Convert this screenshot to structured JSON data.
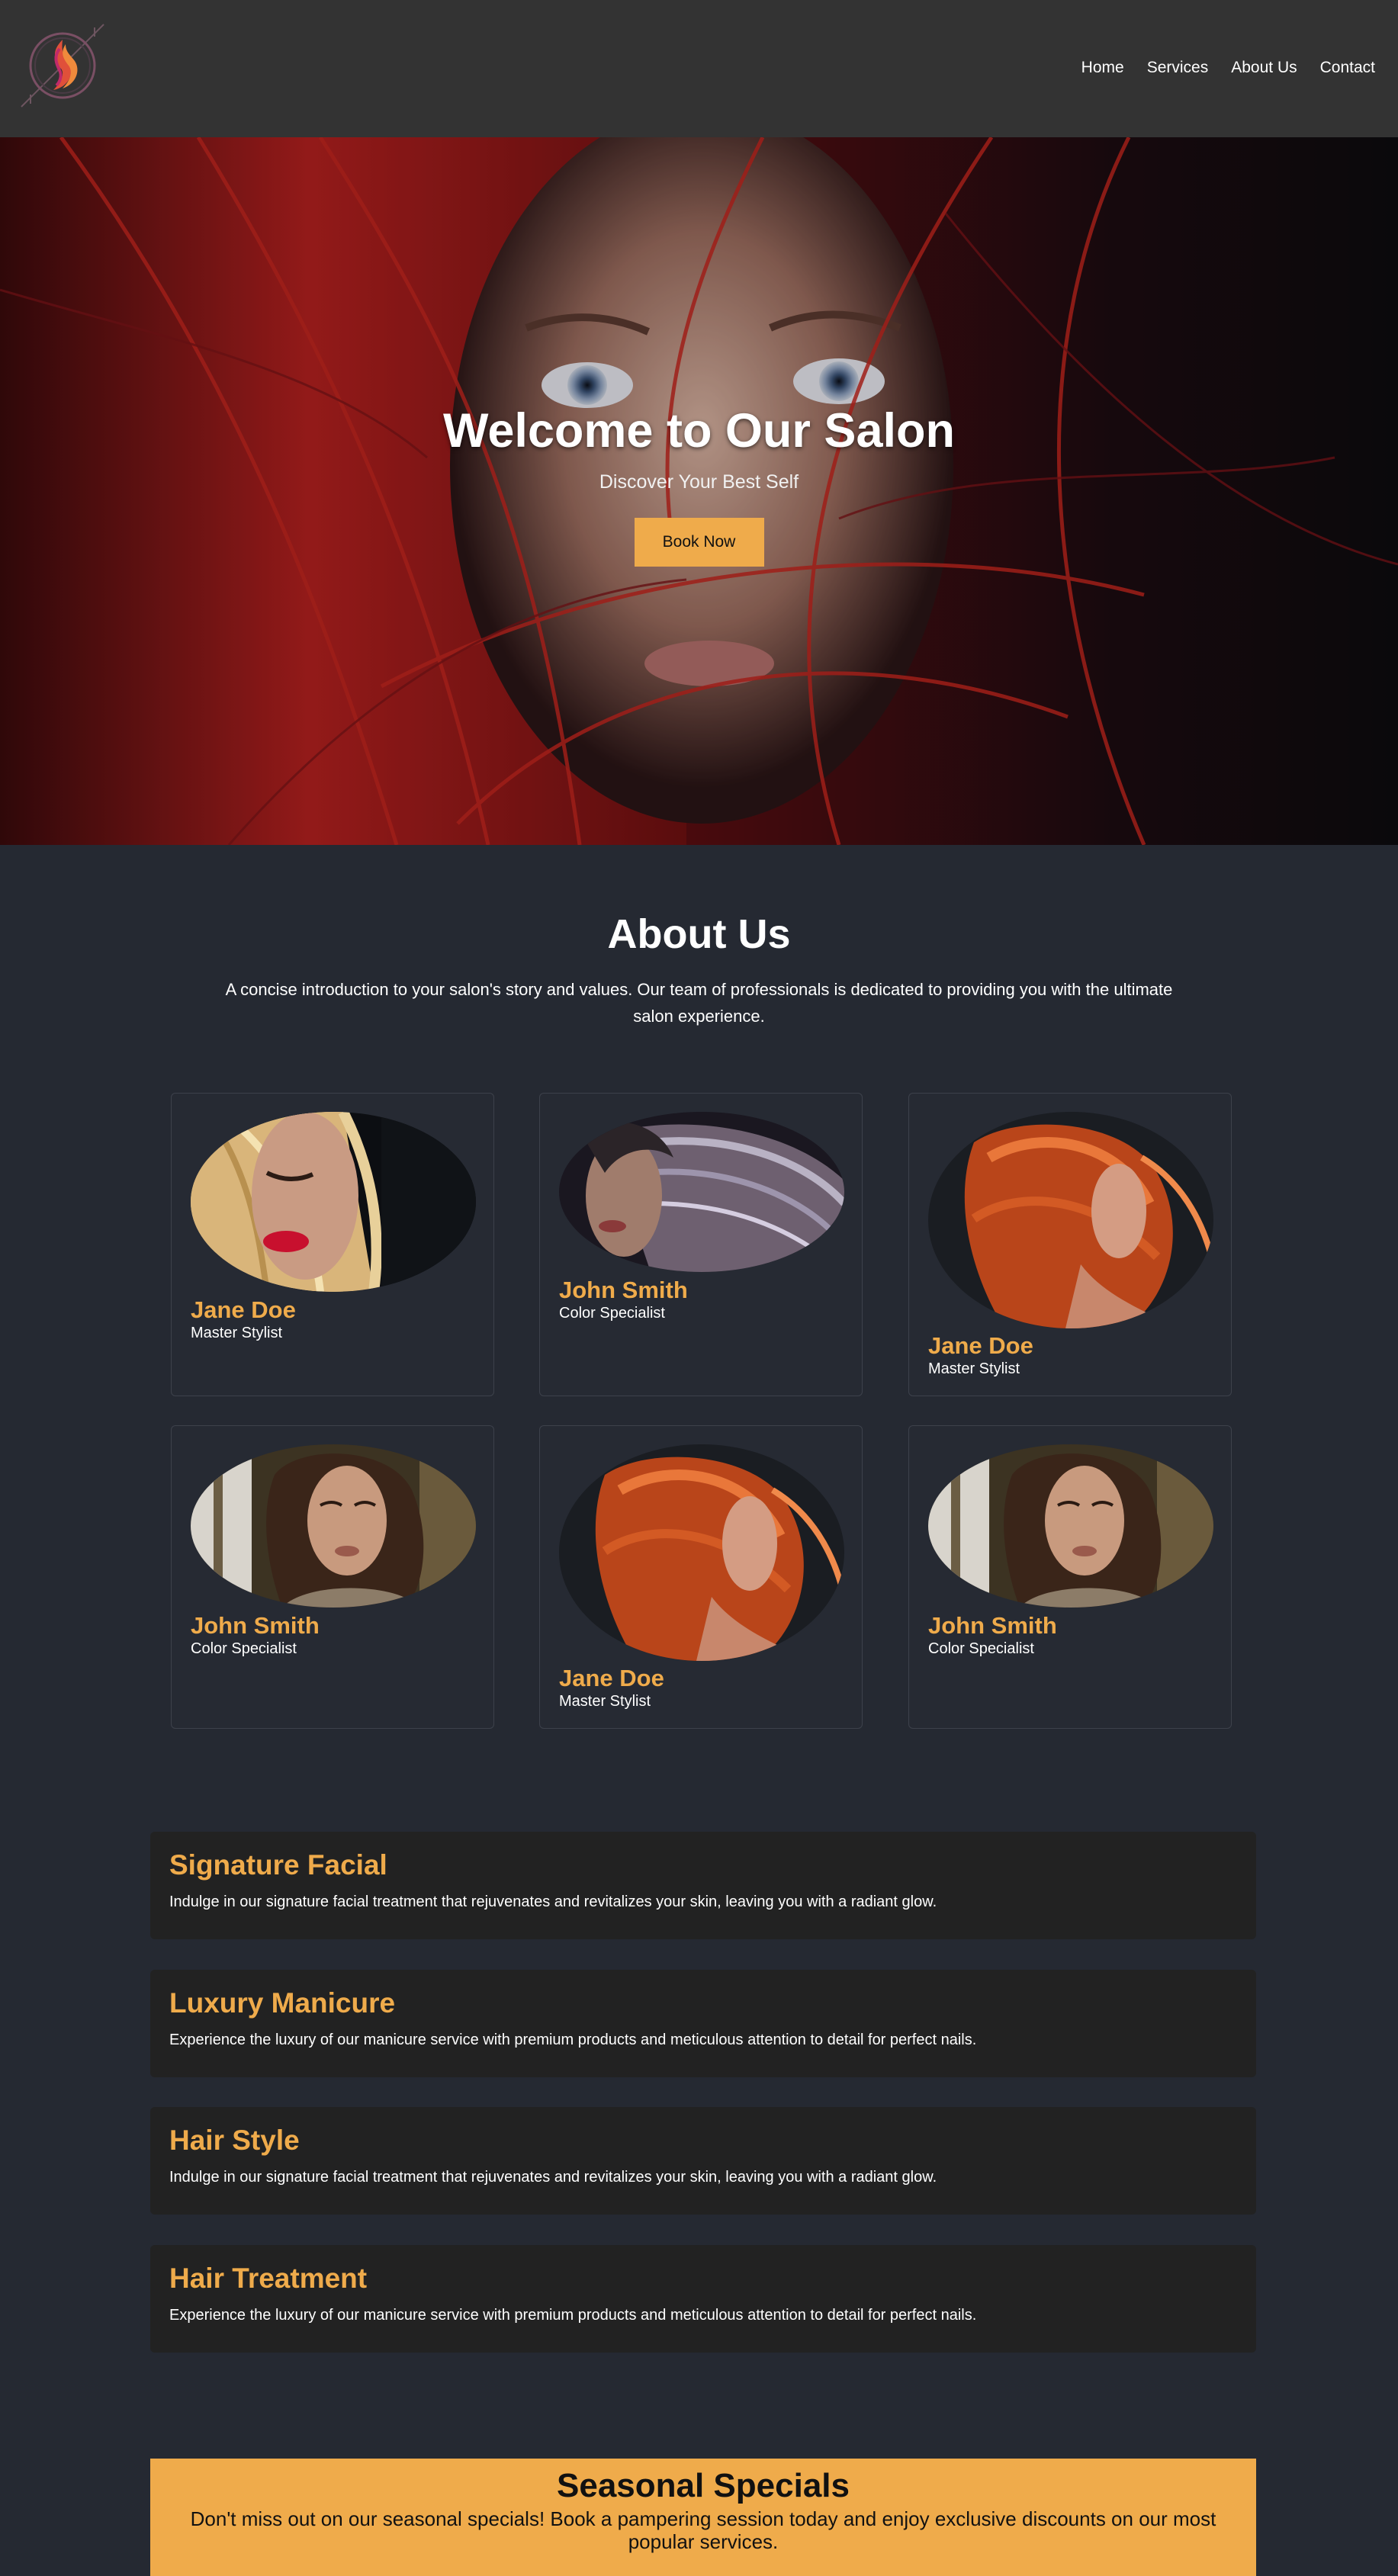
{
  "colors": {
    "page_background": "#252932",
    "header_background": "#333333",
    "accent": "#efab4b",
    "card_border": "#3d414b",
    "service_background": "#222222"
  },
  "header": {
    "logo_icon": "hair-flame-logo",
    "nav": [
      {
        "label": "Home"
      },
      {
        "label": "Services"
      },
      {
        "label": "About Us"
      },
      {
        "label": "Contact"
      }
    ]
  },
  "hero": {
    "title": "Welcome to Our Salon",
    "subtitle": "Discover Your Best Self",
    "button_label": "Book Now",
    "image_subject": "woman with red hair"
  },
  "about": {
    "title": "About Us",
    "text": "A concise introduction to your salon's story and values. Our team of professionals is dedicated to providing you with the ultimate salon experience."
  },
  "team": [
    {
      "name": "Jane Doe",
      "role": "Master Stylist",
      "photo": "blonde-stylist"
    },
    {
      "name": "John Smith",
      "role": "Color Specialist",
      "photo": "silver-hair-stylist"
    },
    {
      "name": "Jane Doe",
      "role": "Master Stylist",
      "photo": "copper-hair-stylist"
    },
    {
      "name": "John Smith",
      "role": "Color Specialist",
      "photo": "brunette-stylist"
    },
    {
      "name": "Jane Doe",
      "role": "Master Stylist",
      "photo": "copper-hair-stylist"
    },
    {
      "name": "John Smith",
      "role": "Color Specialist",
      "photo": "brunette-stylist"
    }
  ],
  "services": [
    {
      "title": "Signature Facial",
      "text": "Indulge in our signature facial treatment that rejuvenates and revitalizes your skin, leaving you with a radiant glow."
    },
    {
      "title": "Luxury Manicure",
      "text": "Experience the luxury of our manicure service with premium products and meticulous attention to detail for perfect nails."
    },
    {
      "title": "Hair Style",
      "text": "Indulge in our signature facial treatment that rejuvenates and revitalizes your skin, leaving you with a radiant glow."
    },
    {
      "title": "Hair Treatment",
      "text": "Experience the luxury of our manicure service with premium products and meticulous attention to detail for perfect nails."
    }
  ],
  "specials": {
    "title": "Seasonal Specials",
    "text": "Don't miss out on our seasonal specials! Book a pampering session today and enjoy exclusive discounts on our most popular services."
  }
}
